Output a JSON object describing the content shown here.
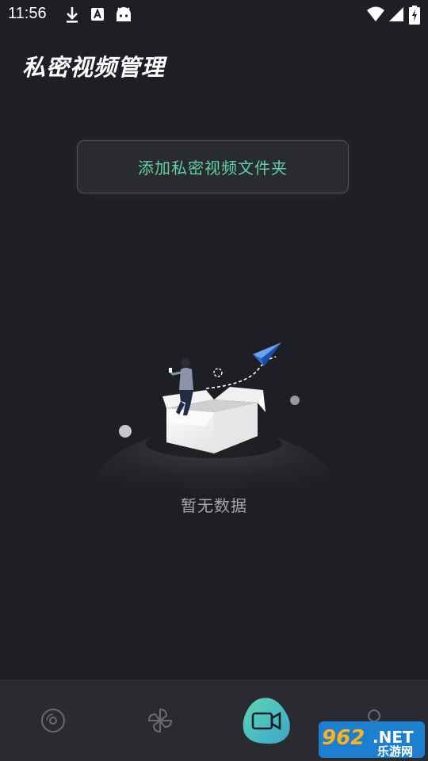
{
  "status_bar": {
    "time": "11:56",
    "left_icons": [
      "download-icon",
      "font-a-icon",
      "android-icon"
    ],
    "right_icons": [
      "wifi-icon",
      "cellular-signal-icon",
      "battery-charging-icon"
    ]
  },
  "header": {
    "title": "私密视频管理"
  },
  "main": {
    "add_folder_label": "添加私密视频文件夹",
    "empty_text": "暂无数据"
  },
  "bottom_nav": {
    "items": [
      {
        "icon": "disc-icon",
        "active": false
      },
      {
        "icon": "pinwheel-icon",
        "active": false
      },
      {
        "icon": "video-camera-icon",
        "active": true
      },
      {
        "icon": "user-icon",
        "active": false
      }
    ]
  },
  "watermark": {
    "number": "962",
    "suffix": ".NET",
    "subtitle": "乐游网"
  },
  "colors": {
    "background": "#1e1f24",
    "accent": "#5fd1a2",
    "nav_background": "#2a2b30"
  }
}
